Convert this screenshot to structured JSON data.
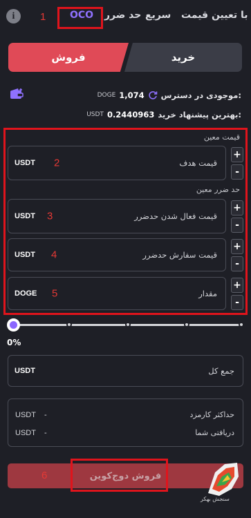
{
  "tabs": {
    "fixed_price": "با تعیین قیمت",
    "fast": "سریع",
    "stop_loss": "حد ضرر",
    "oco": "OCO",
    "info_icon": "info-icon"
  },
  "side": {
    "buy": "خرید",
    "sell": "فروش"
  },
  "balance": {
    "label": "موجودی در دسترس:",
    "value": "1,074",
    "unit": "DOGE"
  },
  "best_bid": {
    "label": "بهترین پیشنهاد خرید:",
    "value": "0.2440963",
    "unit": "USDT"
  },
  "sections": {
    "fixed_price": "قیمت معین",
    "stop_loss": "حد ضرر معین"
  },
  "fields": [
    {
      "placeholder": "قیمت هدف",
      "unit": "USDT",
      "marker": "2"
    },
    {
      "placeholder": "قیمت فعال شدن حدضرر",
      "unit": "USDT",
      "marker": "3"
    },
    {
      "placeholder": "قیمت سفارش حدضرر",
      "unit": "USDT",
      "marker": "4"
    },
    {
      "placeholder": "مقدار",
      "unit": "DOGE",
      "marker": "5"
    }
  ],
  "stepper": {
    "plus": "+",
    "minus": "-"
  },
  "slider": {
    "percent_label": "0%",
    "value": 0
  },
  "total": {
    "placeholder": "جمع کل",
    "unit": "USDT"
  },
  "summary": {
    "max_fee_label": "حداکثر کارمزد",
    "max_fee_value": "-",
    "max_fee_unit": "USDT",
    "receive_label": "دریافتی شما",
    "receive_value": "-",
    "receive_unit": "USDT"
  },
  "cta": "فروش دوج‌کوین",
  "markers": {
    "m1": "1",
    "m6": "6"
  },
  "logo_text": "سنجش بهکر",
  "colors": {
    "accent": "#8f71ff",
    "sell": "#e04a57",
    "annotation": "#e0141c"
  }
}
